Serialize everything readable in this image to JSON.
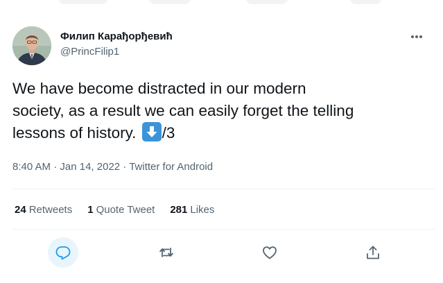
{
  "author": {
    "name": "Филип Карађорђевић",
    "handle": "@PrincFilip1"
  },
  "tweet": {
    "text_before_emoji": "We have become distracted in our modern\nsociety, as a result we can easily forget the telling\nlessons of history. ",
    "text_after_emoji": "/3",
    "emoji": "down-arrow-emoji"
  },
  "meta": {
    "time": "8:40 AM",
    "separator_1": " · ",
    "date": "Jan 14, 2022",
    "separator_2": " · ",
    "source": "Twitter for Android"
  },
  "stats": {
    "retweets": {
      "count": "24",
      "label": "Retweets"
    },
    "quote_tweets": {
      "count": "1",
      "label": "Quote Tweet"
    },
    "likes": {
      "count": "281",
      "label": "Likes"
    }
  },
  "actions": [
    {
      "name": "reply",
      "icon": "reply-icon"
    },
    {
      "name": "retweet",
      "icon": "retweet-icon"
    },
    {
      "name": "like",
      "icon": "heart-icon"
    },
    {
      "name": "share",
      "icon": "share-icon"
    }
  ],
  "colors": {
    "text": "#0f1419",
    "secondary": "#536471",
    "accent": "#1d9bf0",
    "reply_highlight": "#e8f5fd",
    "divider": "#eff3f4"
  }
}
